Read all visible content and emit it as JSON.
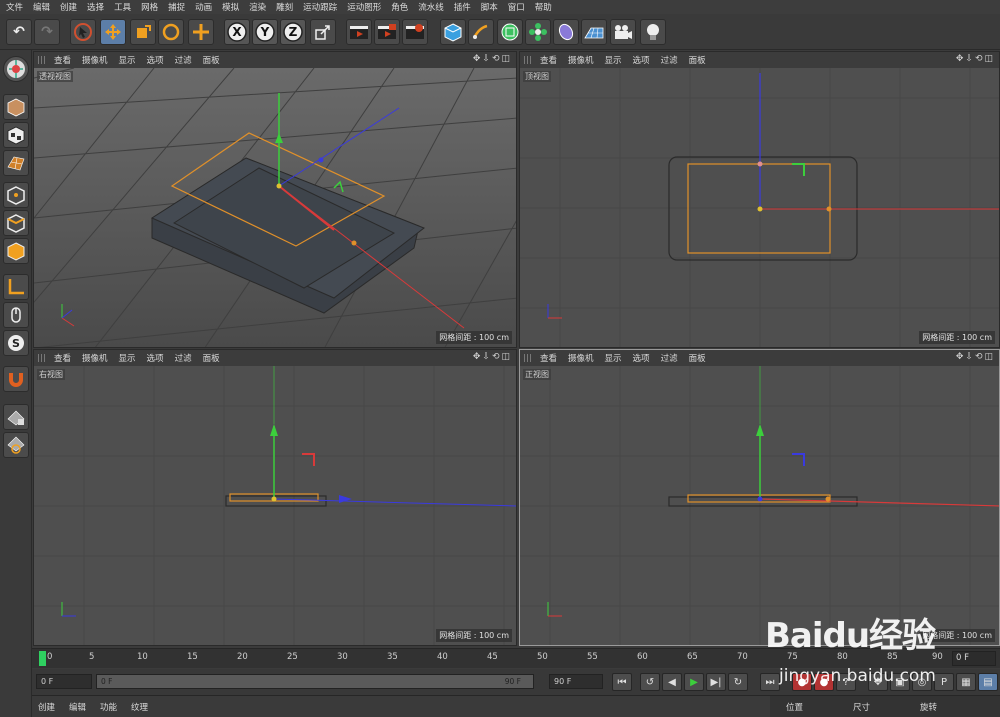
{
  "menu": [
    "文件",
    "编辑",
    "创建",
    "选择",
    "工具",
    "网格",
    "捕捉",
    "动画",
    "模拟",
    "渲染",
    "雕刻",
    "运动跟踪",
    "运动图形",
    "角色",
    "流水线",
    "插件",
    "脚本",
    "窗口",
    "帮助"
  ],
  "viewport_menu": [
    "查看",
    "摄像机",
    "显示",
    "选项",
    "过滤",
    "面板"
  ],
  "viewports": {
    "perspective": {
      "name": "透视视图",
      "grid": "网格间距 : 100 cm"
    },
    "top": {
      "name": "顶视图",
      "grid": "网格间距 : 100 cm"
    },
    "right": {
      "name": "右视图",
      "grid": "网格间距 : 100 cm"
    },
    "front": {
      "name": "正视图",
      "grid": "网格间距 : 100 cm"
    }
  },
  "toolbar": {
    "axis_x": "X",
    "axis_y": "Y",
    "axis_z": "Z"
  },
  "timeline": {
    "ticks": [
      "0",
      "5",
      "10",
      "15",
      "20",
      "25",
      "30",
      "35",
      "40",
      "45",
      "50",
      "55",
      "60",
      "65",
      "70",
      "75",
      "80",
      "85",
      "90"
    ],
    "end_frame": "0 F"
  },
  "transport": {
    "current_frame": "0 F",
    "range_start": "0 F",
    "range_end": "90 F",
    "max_frame": "90 F"
  },
  "bottom_menu": [
    "创建",
    "编辑",
    "功能",
    "纹理"
  ],
  "coord_headers": [
    "位置",
    "尺寸",
    "旋转"
  ],
  "watermark": {
    "logo": "Baidu经验",
    "url": "jingyan.baidu.com"
  },
  "colors": {
    "axis_x": "#d83a3a",
    "axis_y": "#3ccf3c",
    "axis_z": "#3a3adf",
    "selection": "#e0902a",
    "viewport_bg": "#4f4f4f"
  }
}
